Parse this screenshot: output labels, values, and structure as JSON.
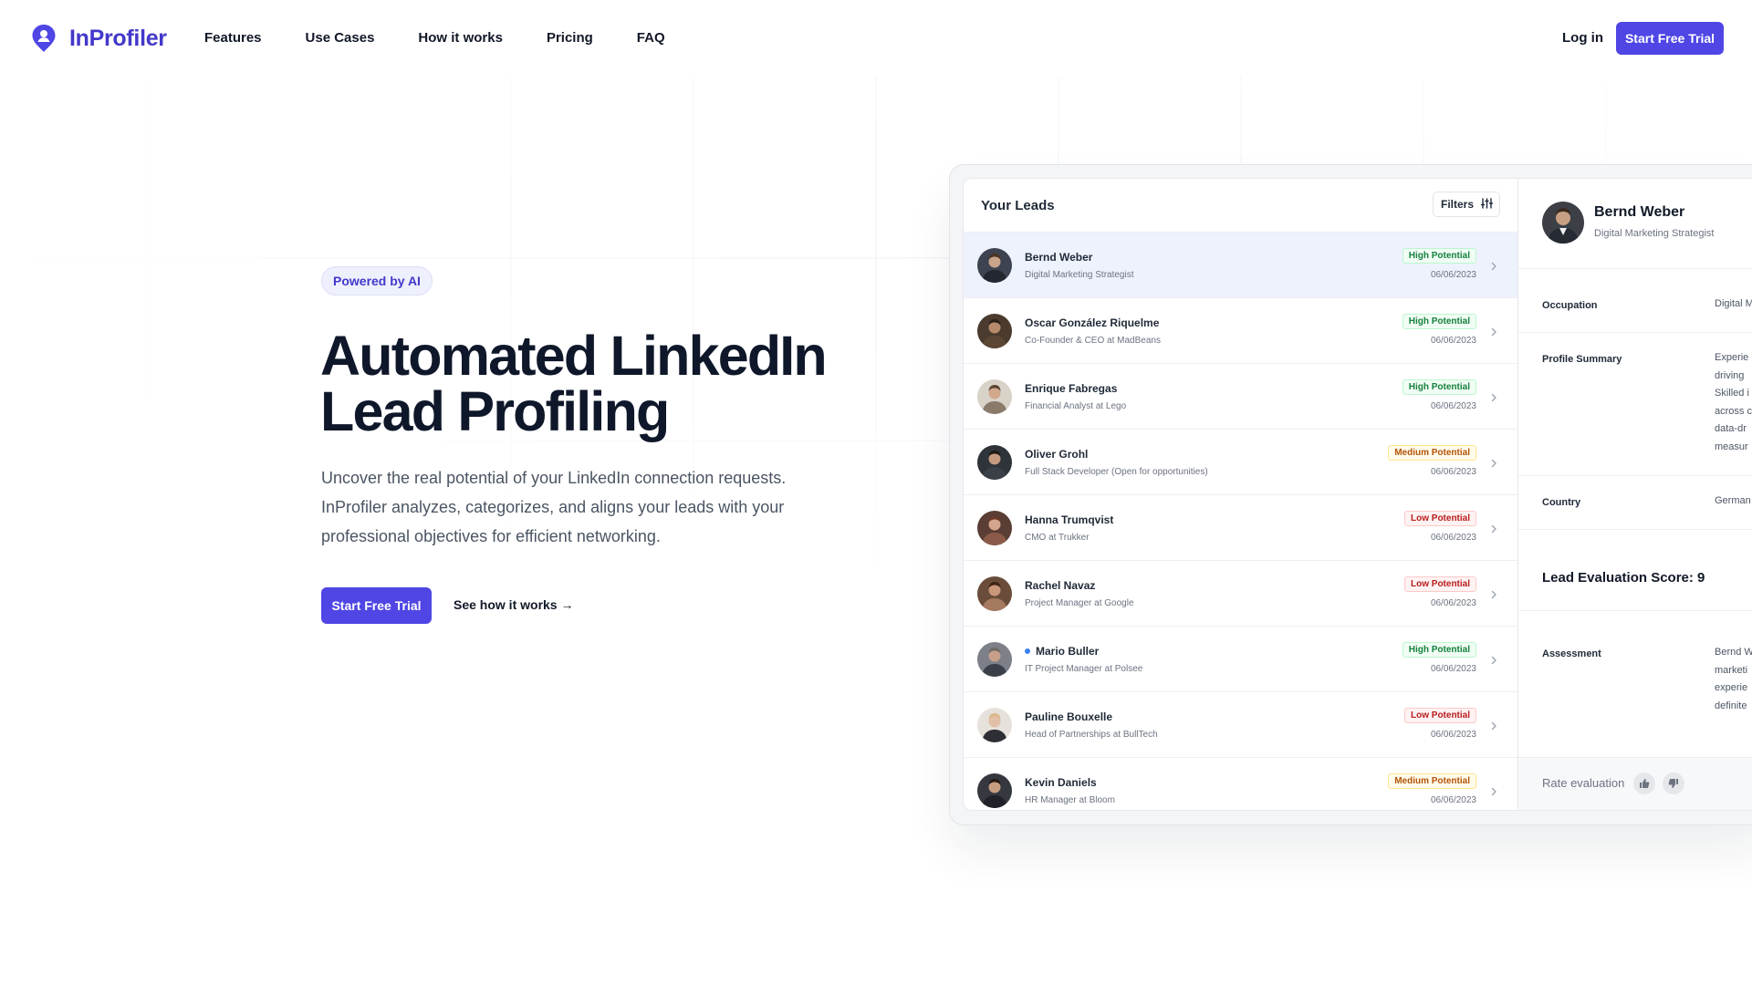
{
  "brand": {
    "name": "InProfiler",
    "accent": "#4f46e5"
  },
  "nav": {
    "links": [
      "Features",
      "Use Cases",
      "How it works",
      "Pricing",
      "FAQ"
    ],
    "login": "Log in",
    "cta": "Start Free Trial"
  },
  "hero": {
    "badge": "Powered by AI",
    "title_line1": "Automated LinkedIn",
    "title_line2": "Lead Profiling",
    "description": "Uncover the real potential of your LinkedIn connection requests. InProfiler analyzes, categorizes, and aligns your leads with your professional objectives for efficient networking.",
    "primary_cta": "Start Free Trial",
    "secondary_cta": "See how it works →"
  },
  "app": {
    "leads_title": "Your Leads",
    "filters_label": "Filters",
    "leads": [
      {
        "name": "Bernd Weber",
        "role": "Digital Marketing Strategist",
        "status": "High Potential",
        "level": "high",
        "date": "06/06/2023",
        "active": true,
        "unread": false
      },
      {
        "name": "Oscar González Riquelme",
        "role": "Co-Founder & CEO at MadBeans",
        "status": "High Potential",
        "level": "high",
        "date": "06/06/2023",
        "active": false,
        "unread": false
      },
      {
        "name": "Enrique Fabregas",
        "role": "Financial Analyst at Lego",
        "status": "High Potential",
        "level": "high",
        "date": "06/06/2023",
        "active": false,
        "unread": false
      },
      {
        "name": "Oliver Grohl",
        "role": "Full Stack Developer (Open for opportunities)",
        "status": "Medium Potential",
        "level": "medium",
        "date": "06/06/2023",
        "active": false,
        "unread": false
      },
      {
        "name": "Hanna Trumqvist",
        "role": "CMO at Trukker",
        "status": "Low Potential",
        "level": "low",
        "date": "06/06/2023",
        "active": false,
        "unread": false
      },
      {
        "name": "Rachel Navaz",
        "role": "Project Manager at Google",
        "status": "Low Potential",
        "level": "low",
        "date": "06/06/2023",
        "active": false,
        "unread": false
      },
      {
        "name": "Mario Buller",
        "role": "IT Project Manager at Polsee",
        "status": "High Potential",
        "level": "high",
        "date": "06/06/2023",
        "active": false,
        "unread": true
      },
      {
        "name": "Pauline Bouxelle",
        "role": "Head of Partnerships at BullTech",
        "status": "Low Potential",
        "level": "low",
        "date": "06/06/2023",
        "active": false,
        "unread": false
      },
      {
        "name": "Kevin Daniels",
        "role": "HR Manager at Bloom",
        "status": "Medium Potential",
        "level": "medium",
        "date": "06/06/2023",
        "active": false,
        "unread": false
      }
    ],
    "detail": {
      "name": "Bernd Weber",
      "role": "Digital Marketing Strategist",
      "occupation_label": "Occupation",
      "occupation_value": "Digital M",
      "summary_label": "Profile Summary",
      "summary_lines": [
        "Experie",
        "driving",
        "Skilled i",
        "across c",
        "data-dr",
        "measur"
      ],
      "country_label": "Country",
      "country_value": "German",
      "score_label": "Lead Evaluation Score: 9",
      "assessment_label": "Assessment",
      "assessment_lines": [
        "Bernd W",
        "marketi",
        "experie",
        "definite"
      ],
      "rate_label": "Rate evaluation"
    }
  }
}
